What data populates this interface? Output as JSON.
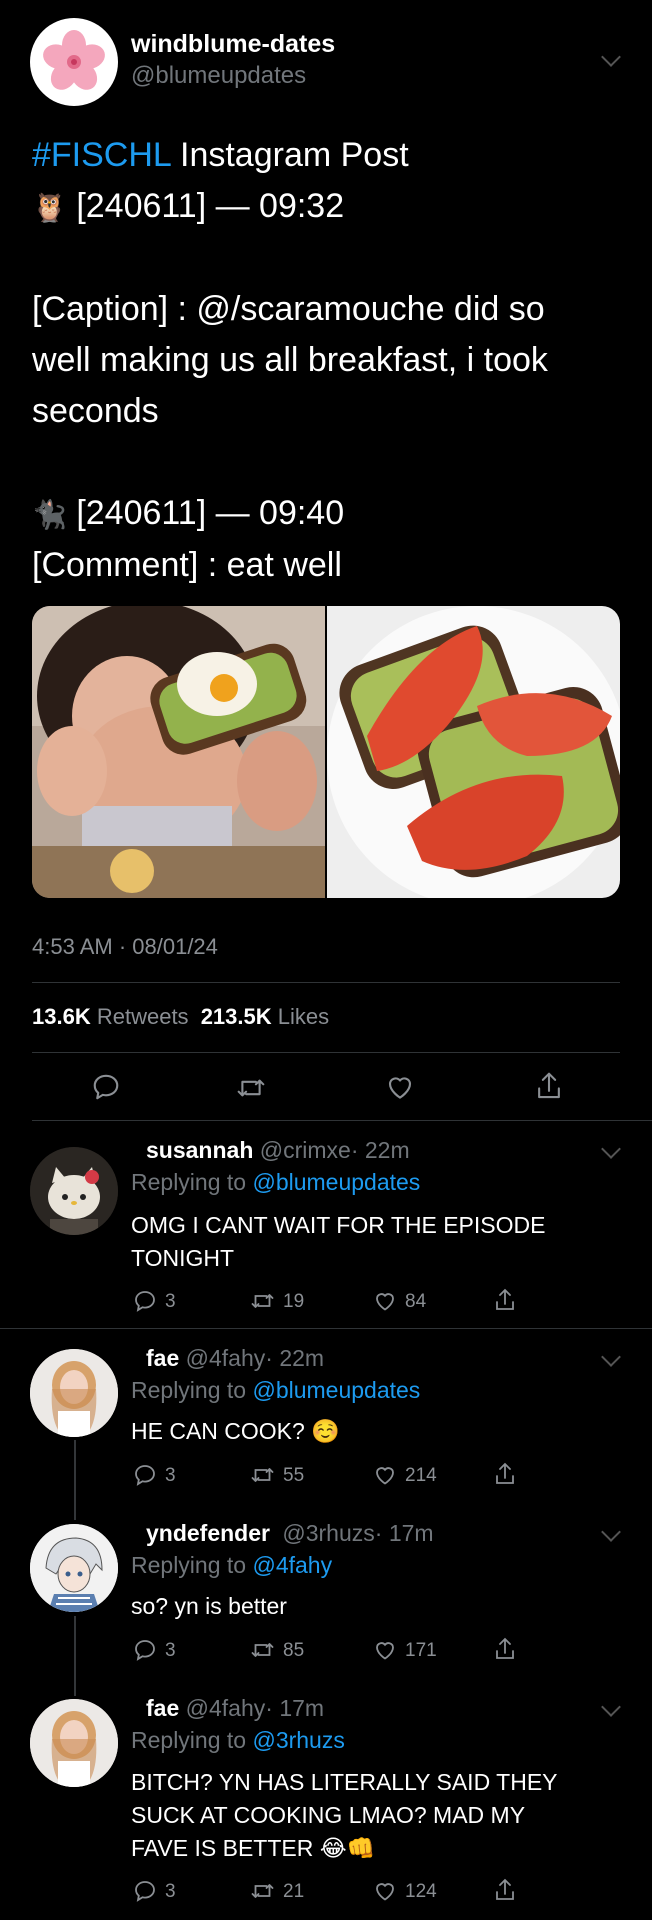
{
  "tweet": {
    "display_name": "windblume-dates",
    "handle": "@blumeupdates",
    "hashtag": "#FISCHL",
    "title_rest": " Instagram Post",
    "emoji_owl": "🦉",
    "post_time": "[240611] — 09:32",
    "caption_line1": "[Caption] : @/scaramouche did so",
    "caption_line2": "well making us all breakfast, i took",
    "caption_line3": "seconds",
    "emoji_cat": "🐈‍⬛",
    "comment_time": "[240611] — 09:40",
    "comment_text": "[Comment] : eat well",
    "timestamp": "4:53 AM · 08/01/24",
    "retweets_count": "13.6K",
    "retweets_label": "Retweets",
    "likes_count": "213.5K",
    "likes_label": "Likes"
  },
  "replies": [
    {
      "name": "susannah",
      "handle": "@crimxe",
      "time": "· 22m",
      "replying_label": "Replying to",
      "replying_to": "@blumeupdates",
      "text_line1": "OMG I CANT WAIT FOR THE EPISODE",
      "text_line2": "TONIGHT",
      "replies": "3",
      "retweets": "19",
      "likes": "84"
    },
    {
      "name": "fae",
      "handle": "@4fahy",
      "time": "· 22m",
      "replying_label": "Replying to",
      "replying_to": "@blumeupdates",
      "text_line1": "HE CAN COOK? ☺️",
      "replies": "3",
      "retweets": "55",
      "likes": "214"
    },
    {
      "name": "yndefender",
      "handle": "@3rhuzs",
      "time": "· 17m",
      "replying_label": "Replying to",
      "replying_to": "@4fahy",
      "text_line1": "so? yn is better",
      "replies": "3",
      "retweets": "85",
      "likes": "171"
    },
    {
      "name": "fae",
      "handle": "@4fahy",
      "time": "· 17m",
      "replying_label": "Replying to",
      "replying_to": "@3rhuzs",
      "text_line1": "BITCH? YN HAS LITERALLY SAID THEY",
      "text_line2": "SUCK AT COOKING LMAO? MAD MY",
      "text_line3": "FAVE IS BETTER 😂👊",
      "replies": "3",
      "retweets": "21",
      "likes": "124"
    }
  ],
  "icons": [
    "blossom-avatar",
    "reply-icon",
    "retweet-icon",
    "like-icon",
    "share-icon",
    "chevron-down-icon"
  ]
}
